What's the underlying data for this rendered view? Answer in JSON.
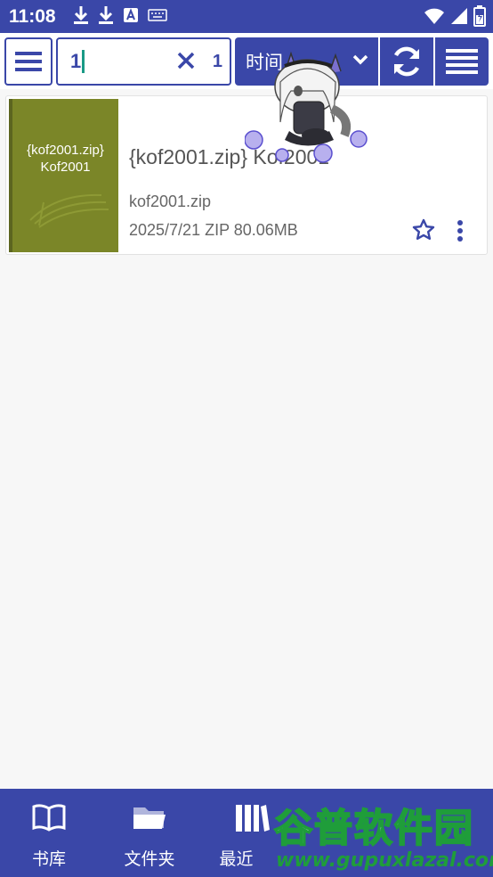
{
  "status_bar": {
    "time": "11:08",
    "battery_level": 0.6
  },
  "toolbar": {
    "search_value": "1",
    "result_count": "1",
    "sort_label": "时间"
  },
  "book": {
    "cover_title": "{kof2001.zip}",
    "cover_subtitle": "Kof2001",
    "title": "{kof2001.zip} Kof2001",
    "filename": "kof2001.zip",
    "meta": "2025/7/21  ZIP  80.06MB"
  },
  "bottom_nav": {
    "items": [
      {
        "label": "书库",
        "icon": "book-open-icon"
      },
      {
        "label": "文件夹",
        "icon": "folder-icon"
      },
      {
        "label": "最近",
        "icon": "bookshelf-icon"
      }
    ]
  },
  "watermark": {
    "text": "谷普软件园",
    "url": "www.gupuxlazal.com"
  },
  "colors": {
    "primary": "#3a47a8",
    "cover": "#7b8628",
    "accent": "#1a9a86"
  }
}
